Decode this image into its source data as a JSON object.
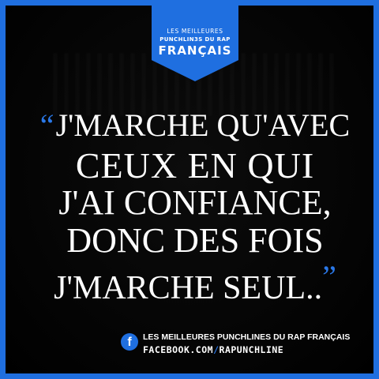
{
  "badge": {
    "line1": "LES MEILLEURES",
    "line2": "PUNCHLIN3S DU RAP",
    "line3": "FRANÇAIS"
  },
  "quote": {
    "open_mark": "“",
    "lines": [
      "J'MARCHE QU'AVEC",
      "CEUX EN QUI",
      "J'AI CONFIANCE,",
      "DONC DES FOIS",
      "J'MARCHE SEUL.."
    ],
    "close_mark": "”"
  },
  "footer": {
    "icon": "facebook-icon",
    "icon_glyph": "f",
    "title": "LES MEILLEURES PUNCHLINES DU RAP FRANÇAIS",
    "url_part1": "FACEBOOK.COM",
    "url_separator": "/",
    "url_part2": "RAPUNCHLINE"
  },
  "colors": {
    "accent": "#1f6fe0",
    "background": "#000000",
    "text": "#ffffff"
  }
}
